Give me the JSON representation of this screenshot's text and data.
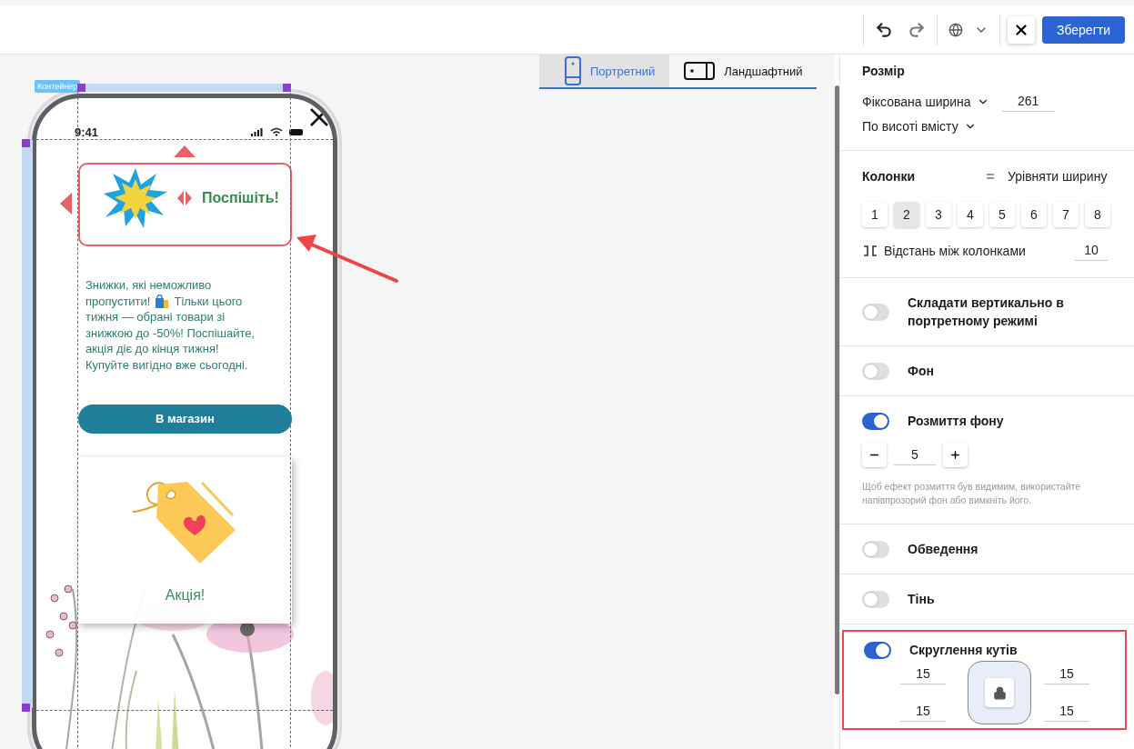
{
  "toolbar": {
    "save_label": "Зберегти"
  },
  "view_tabs": [
    {
      "kind": "portrait",
      "label": "Портретний",
      "selected": true
    },
    {
      "kind": "landscape",
      "label": "Ландшафтний",
      "selected": false
    }
  ],
  "canvas": {
    "selection_label": "Контейнер",
    "status_time": "9:41",
    "hero_title": "Поспішіть!",
    "body_lines": [
      {
        "kind": "text",
        "text": "Знижки, які неможливо"
      },
      {
        "kind": "bag",
        "before": "пропустити!",
        "after": "Тільки цього"
      },
      {
        "kind": "text",
        "text": "тижня — обрані товари зі"
      },
      {
        "kind": "text",
        "text": "знижкою до -50%! Поспішайте,"
      },
      {
        "kind": "text",
        "text": "акція діє до кінця тижня!"
      },
      {
        "kind": "text",
        "text": "Купуйте вигідно вже сьогодні."
      }
    ],
    "button_label": "В магазин",
    "card_caption": "Акція!"
  },
  "panel": {
    "sections": [
      {
        "kind": "size",
        "title": "Розмір",
        "width_mode": "Фіксована ширина",
        "width_value": "261",
        "height_mode": "По висоті вмісту"
      },
      {
        "kind": "columns",
        "title": "Колонки",
        "equalize_label": "Урівняти ширину",
        "options": [
          {
            "label": "1",
            "selected": false
          },
          {
            "label": "2",
            "selected": true
          },
          {
            "label": "3",
            "selected": false
          },
          {
            "label": "4",
            "selected": false
          },
          {
            "label": "5",
            "selected": false
          },
          {
            "label": "6",
            "selected": false
          },
          {
            "label": "7",
            "selected": false
          },
          {
            "label": "8",
            "selected": false
          }
        ],
        "gap_label": "Відстань між колонками",
        "gap_value": "10"
      },
      {
        "kind": "toggle",
        "label": "Складати вертикально в портретному режимі",
        "on": false
      },
      {
        "kind": "toggle",
        "label": "Фон",
        "on": false
      },
      {
        "kind": "stepper",
        "label": "Розмиття фону",
        "on": true,
        "value": "5",
        "hint": "Щоб ефект розмиття був видимим, використайте напівпрозорий фон або вимкніть його."
      },
      {
        "kind": "toggle",
        "label": "Обведення",
        "on": false
      },
      {
        "kind": "toggle",
        "label": "Тінь",
        "on": false
      },
      {
        "kind": "corners",
        "label": "Скруглення кутів",
        "on": true,
        "highlighted": true,
        "radii": [
          "15",
          "15",
          "15",
          "15"
        ]
      }
    ]
  }
}
